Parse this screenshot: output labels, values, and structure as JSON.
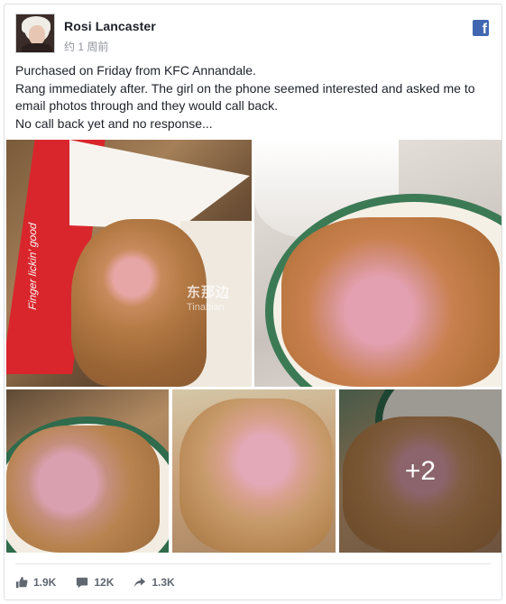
{
  "post": {
    "author": "Rosi Lancaster",
    "timestamp": "约 1 周前",
    "brand_icon": "facebook-logo",
    "text_lines": [
      "Purchased on Friday from KFC Annandale.",
      "Rang immediately after. The girl on the phone seemed interested and asked me to",
      "email photos through and they would call back.",
      "No call back yet and no response..."
    ],
    "photos": {
      "more_count_label": "+2",
      "watermark_text": "东那边",
      "watermark_subtext": "Tinabian",
      "box_print_text": "Finger lickin' good"
    },
    "stats": {
      "likes": "1.9K",
      "comments": "12K",
      "shares": "1.3K"
    }
  },
  "colors": {
    "facebook_blue": "#4267b2",
    "text_primary": "#1d2129",
    "text_secondary": "#90949c",
    "stat_text": "#606770"
  }
}
